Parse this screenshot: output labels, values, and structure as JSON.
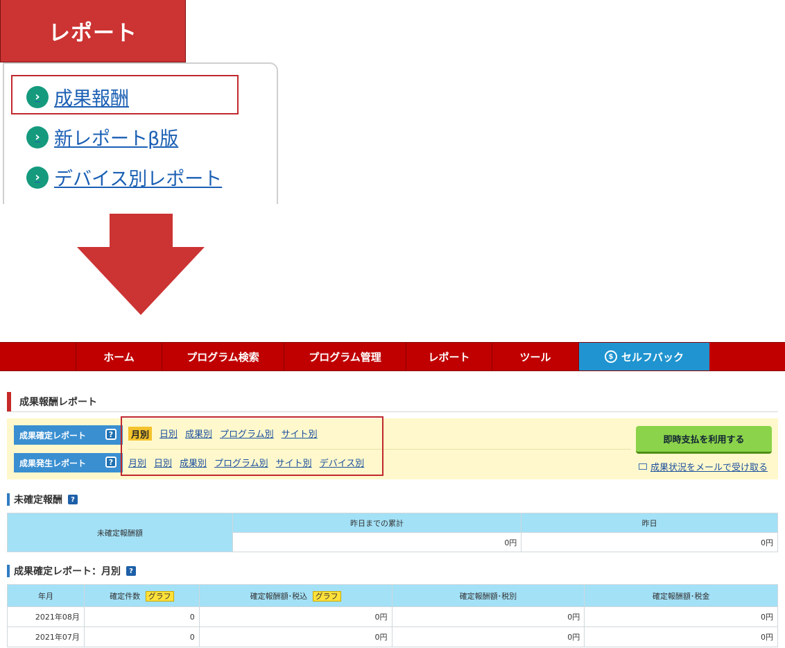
{
  "report_tab": {
    "label": "レポート"
  },
  "report_menu": {
    "items": [
      {
        "label": "成果報酬"
      },
      {
        "label": "新レポートβ版"
      },
      {
        "label": "デバイス別レポート"
      }
    ]
  },
  "nav": {
    "items": [
      {
        "label": "ホーム"
      },
      {
        "label": "プログラム検索"
      },
      {
        "label": "プログラム管理"
      },
      {
        "label": "レポート"
      },
      {
        "label": "ツール"
      },
      {
        "label": "セルフバック"
      }
    ]
  },
  "page_title": "成果報酬レポート",
  "panel": {
    "confirmed_label": "成果確定レポート",
    "occurred_label": "成果発生レポート",
    "confirmed_links": [
      "月別",
      "日別",
      "成果別",
      "プログラム別",
      "サイト別"
    ],
    "occurred_links": [
      "月別",
      "日別",
      "成果別",
      "プログラム別",
      "サイト別",
      "デバイス別"
    ],
    "instant_pay_label": "即時支払を利用する",
    "mail_link_label": "成果状況をメールで受け取る"
  },
  "unconfirmed": {
    "title": "未確定報酬",
    "row_label": "未確定報酬額",
    "col_cumulative": "昨日までの累計",
    "col_yesterday": "昨日",
    "cumulative_value": "0円",
    "yesterday_value": "0円"
  },
  "monthly": {
    "title": "成果確定レポート：月別",
    "headers": {
      "month": "年月",
      "count": "確定件数",
      "incl_tax": "確定報酬額･税込",
      "excl_tax": "確定報酬額･税別",
      "tax": "確定報酬額･税金",
      "graph": "グラフ"
    },
    "rows": [
      {
        "month": "2021年08月",
        "count": "0",
        "incl": "0円",
        "excl": "0円",
        "tax": "0円"
      },
      {
        "month": "2021年07月",
        "count": "0",
        "incl": "0円",
        "excl": "0円",
        "tax": "0円"
      }
    ]
  },
  "colors": {
    "brand_red": "#c00000",
    "self_back_blue": "#1f94d0",
    "panel_yellow": "#fff8cc",
    "header_blue": "#a3e1f7",
    "green_button": "#8bd34a"
  }
}
